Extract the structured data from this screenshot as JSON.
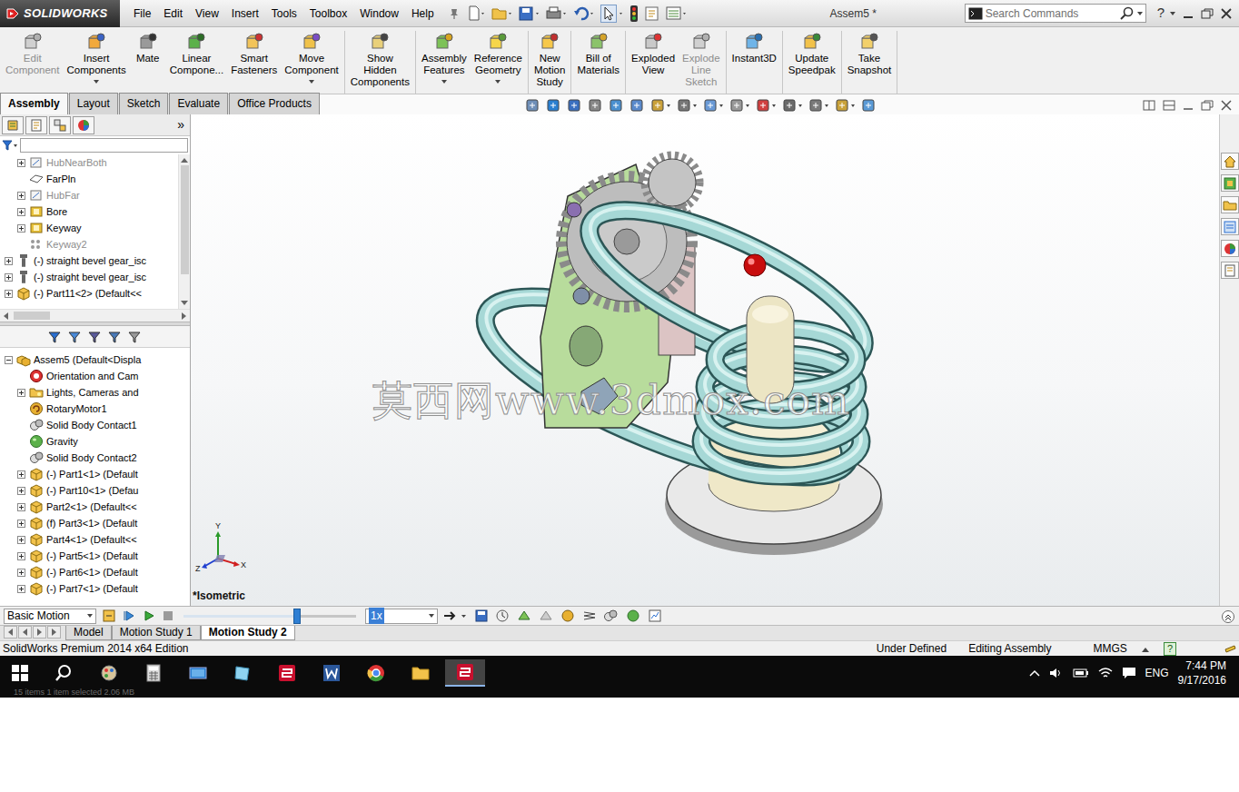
{
  "window": {
    "logo": "SOLIDWORKS",
    "title": "Assem5 *"
  },
  "menu": [
    "File",
    "Edit",
    "View",
    "Insert",
    "Tools",
    "Toolbox",
    "Window",
    "Help"
  ],
  "search": {
    "placeholder": "Search Commands"
  },
  "help": "?",
  "ribbon_groups": [
    [
      {
        "lines": [
          "Edit",
          "Component"
        ],
        "disabled": true,
        "dropdown": false
      },
      {
        "lines": [
          "Insert",
          "Components"
        ],
        "disabled": false,
        "dropdown": true
      },
      {
        "lines": [
          "Mate"
        ],
        "disabled": false,
        "dropdown": false
      },
      {
        "lines": [
          "Linear",
          "Compone..."
        ],
        "disabled": false,
        "dropdown": false
      },
      {
        "lines": [
          "Smart",
          "Fasteners"
        ],
        "disabled": false,
        "dropdown": false
      },
      {
        "lines": [
          "Move",
          "Component"
        ],
        "disabled": false,
        "dropdown": true
      }
    ],
    [
      {
        "lines": [
          "Show",
          "Hidden",
          "Components"
        ],
        "disabled": false,
        "dropdown": false
      }
    ],
    [
      {
        "lines": [
          "Assembly",
          "Features"
        ],
        "disabled": false,
        "dropdown": true
      },
      {
        "lines": [
          "Reference",
          "Geometry"
        ],
        "disabled": false,
        "dropdown": true
      }
    ],
    [
      {
        "lines": [
          "New",
          "Motion",
          "Study"
        ],
        "disabled": false,
        "dropdown": false
      }
    ],
    [
      {
        "lines": [
          "Bill of",
          "Materials"
        ],
        "disabled": false,
        "dropdown": false
      }
    ],
    [
      {
        "lines": [
          "Exploded",
          "View"
        ],
        "disabled": false,
        "dropdown": false
      },
      {
        "lines": [
          "Explode",
          "Line",
          "Sketch"
        ],
        "disabled": true,
        "dropdown": false
      }
    ],
    [
      {
        "lines": [
          "Instant3D"
        ],
        "disabled": false,
        "dropdown": false
      }
    ],
    [
      {
        "lines": [
          "Update",
          "Speedpak"
        ],
        "disabled": false,
        "dropdown": false
      }
    ],
    [
      {
        "lines": [
          "Take",
          "Snapshot"
        ],
        "disabled": false,
        "dropdown": false
      }
    ]
  ],
  "ribbon_tabs": [
    {
      "label": "Assembly",
      "selected": true
    },
    {
      "label": "Layout",
      "selected": false
    },
    {
      "label": "Sketch",
      "selected": false
    },
    {
      "label": "Evaluate",
      "selected": false
    },
    {
      "label": "Office Products",
      "selected": false
    }
  ],
  "panel": {
    "collapse": "»",
    "filter_text": ""
  },
  "tree_top": [
    {
      "label": "HubNearBoth",
      "kind": "sketch",
      "level": 1,
      "greyed": true,
      "expandable": true,
      "expanded": false
    },
    {
      "label": "FarPln",
      "kind": "plane",
      "level": 1,
      "greyed": false,
      "expandable": false,
      "expanded": false
    },
    {
      "label": "HubFar",
      "kind": "sketch",
      "level": 1,
      "greyed": true,
      "expandable": true,
      "expanded": false
    },
    {
      "label": "Bore",
      "kind": "feature",
      "level": 1,
      "greyed": false,
      "expandable": true,
      "expanded": false
    },
    {
      "label": "Keyway",
      "kind": "feature",
      "level": 1,
      "greyed": false,
      "expandable": true,
      "expanded": false
    },
    {
      "label": "Keyway2",
      "kind": "pattern",
      "level": 1,
      "greyed": true,
      "expandable": false,
      "expanded": false
    },
    {
      "label": "(-) straight bevel gear_isc",
      "kind": "fastener",
      "level": 0,
      "greyed": false,
      "expandable": true,
      "expanded": false
    },
    {
      "label": "(-) straight bevel gear_isc",
      "kind": "fastener",
      "level": 0,
      "greyed": false,
      "expandable": true,
      "expanded": false
    },
    {
      "label": "(-) Part11<2> (Default<<",
      "kind": "part",
      "level": 0,
      "greyed": false,
      "expandable": true,
      "expanded": false
    }
  ],
  "tree": [
    {
      "label": "Assem5  (Default<Displa",
      "kind": "assembly",
      "level": 0,
      "greyed": false,
      "expandable": true,
      "expanded": true
    },
    {
      "label": "Orientation and Cam",
      "kind": "orientation",
      "level": 1,
      "greyed": false,
      "expandable": false,
      "expanded": false
    },
    {
      "label": "Lights, Cameras and",
      "kind": "folder",
      "level": 1,
      "greyed": false,
      "expandable": true,
      "expanded": false
    },
    {
      "label": "RotaryMotor1",
      "kind": "motor",
      "level": 1,
      "greyed": false,
      "expandable": false,
      "expanded": false
    },
    {
      "label": "Solid Body Contact1",
      "kind": "contact",
      "level": 1,
      "greyed": false,
      "expandable": false,
      "expanded": false
    },
    {
      "label": "Gravity",
      "kind": "gravity",
      "level": 1,
      "greyed": false,
      "expandable": false,
      "expanded": false
    },
    {
      "label": "Solid Body Contact2",
      "kind": "contact",
      "level": 1,
      "greyed": false,
      "expandable": false,
      "expanded": false
    },
    {
      "label": "(-) Part1<1> (Default",
      "kind": "part",
      "level": 1,
      "greyed": false,
      "expandable": true,
      "expanded": false
    },
    {
      "label": "(-) Part10<1> (Defau",
      "kind": "part",
      "level": 1,
      "greyed": false,
      "expandable": true,
      "expanded": false
    },
    {
      "label": "Part2<1> (Default<<",
      "kind": "part",
      "level": 1,
      "greyed": false,
      "expandable": true,
      "expanded": false
    },
    {
      "label": "(f) Part3<1> (Default",
      "kind": "part",
      "level": 1,
      "greyed": false,
      "expandable": true,
      "expanded": false
    },
    {
      "label": "Part4<1> (Default<<",
      "kind": "part",
      "level": 1,
      "greyed": false,
      "expandable": true,
      "expanded": false
    },
    {
      "label": "(-) Part5<1> (Default",
      "kind": "part",
      "level": 1,
      "greyed": false,
      "expandable": true,
      "expanded": false
    },
    {
      "label": "(-) Part6<1> (Default",
      "kind": "part",
      "level": 1,
      "greyed": false,
      "expandable": true,
      "expanded": false
    },
    {
      "label": "(-) Part7<1> (Default",
      "kind": "part",
      "level": 1,
      "greyed": false,
      "expandable": true,
      "expanded": false
    }
  ],
  "viewport": {
    "view_label": "*Isometric",
    "watermark": "莫西网www.3dmox.com",
    "axes": {
      "y": "Y",
      "x": "X",
      "z": "Z"
    }
  },
  "motion": {
    "study_type": "Basic Motion",
    "speed": "1x",
    "level": 0.66
  },
  "motion_tabs": [
    {
      "label": "Model",
      "selected": false
    },
    {
      "label": "Motion Study 1",
      "selected": false
    },
    {
      "label": "Motion Study 2",
      "selected": true
    }
  ],
  "status_bar": {
    "edition": "SolidWorks Premium 2014 x64 Edition",
    "state": "Under Defined",
    "mode": "Editing Assembly",
    "units": "MMGS",
    "help": "?"
  },
  "explorer_status": "15 items    1 item selected  2.06 MB",
  "taskbar": {
    "language": "ENG",
    "time": "7:44 PM",
    "date": "9/17/2016"
  }
}
